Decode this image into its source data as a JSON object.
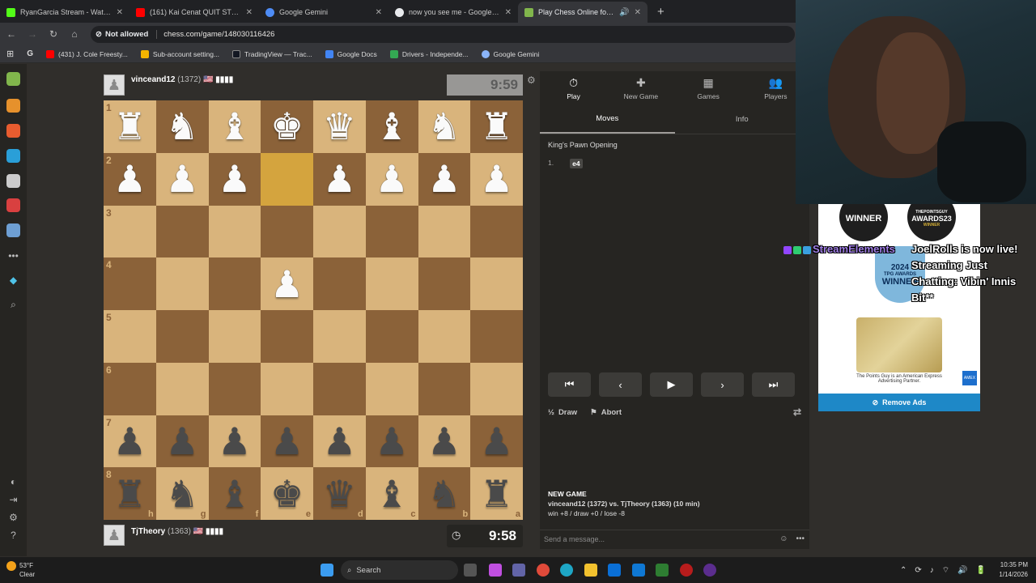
{
  "browser": {
    "tabs": [
      {
        "title": "RyanGarcia Stream - Watch Live",
        "color": "#53fc18",
        "active": false
      },
      {
        "title": "(161) Kai Cenat QUIT STREAMIN",
        "color": "#ff0000",
        "active": false
      },
      {
        "title": "Google Gemini",
        "color": "#4e8cf5",
        "active": false
      },
      {
        "title": "now you see me - Google Search",
        "color": "#e8eaed",
        "active": false
      },
      {
        "title": "Play Chess Online for FREE",
        "color": "#81b64c",
        "active": true
      }
    ],
    "security": "Not allowed",
    "url": "chess.com/game/148030116426",
    "bookmarks": [
      {
        "label": "(431) J. Cole Freesty...",
        "color": "#ff0000"
      },
      {
        "label": "Sub-account setting...",
        "color": "#f4b400"
      },
      {
        "label": "TradingView — Trac...",
        "color": "#131722"
      },
      {
        "label": "Google Docs",
        "color": "#4285f4"
      },
      {
        "label": "Drivers - Independe...",
        "color": "#34a853"
      },
      {
        "label": "Google Gemini",
        "color": "#8ab4f8"
      }
    ]
  },
  "game": {
    "top_player": {
      "name": "vinceand12",
      "rating": "(1372)",
      "flag": "🇺🇸",
      "bars": "▮▮▮▮",
      "clock": "9:59"
    },
    "bottom_player": {
      "name": "TjTheory",
      "rating": "(1363)",
      "flag": "🇺🇸",
      "bars": "▮▮▮▮",
      "clock": "9:58"
    },
    "rank_labels": [
      "1",
      "2",
      "3",
      "4",
      "5",
      "6",
      "7",
      "8"
    ],
    "file_labels": [
      "h",
      "g",
      "f",
      "e",
      "d",
      "c",
      "b",
      "a"
    ],
    "white_back": [
      "♜",
      "♞",
      "♝",
      "♚",
      "♛",
      "♝",
      "♞",
      "♜"
    ],
    "black_back": [
      "♜",
      "♞",
      "♝",
      "♚",
      "♛",
      "♝",
      "♞",
      "♜"
    ],
    "white_pawn": "♟",
    "black_pawn": "♟"
  },
  "panel": {
    "tabs": [
      {
        "icon": "⏱",
        "label": "Play"
      },
      {
        "icon": "✚",
        "label": "New Game"
      },
      {
        "icon": "▦",
        "label": "Games"
      },
      {
        "icon": "👥",
        "label": "Players"
      }
    ],
    "subtabs": [
      "Moves",
      "Info"
    ],
    "opening": "King's Pawn Opening",
    "move_number": "1.",
    "move": "e4",
    "draw": "Draw",
    "abort": "Abort",
    "new_game_heading": "NEW GAME",
    "new_game_line": "vinceand12 (1372) vs. TjTheory (1363) (10 min)",
    "score_line": "win +8 / draw +0 / lose -8",
    "chat_placeholder": "Send a message..."
  },
  "overlay": {
    "award1": "WINNER",
    "award2_top": "THEPOINTSGUY",
    "award2_mid": "AWARDS23",
    "award2_bottom": "WINNER",
    "shield_year": "2024",
    "shield_label": "TPG AWARDS",
    "shield_winner": "WINNER",
    "ad_footer": "The Points Guy is an American Express Advertising Partner.",
    "amex": "AMEX",
    "remove_ads": "Remove Ads",
    "se_name": "StreamElements",
    "se_message": "JoelRolls is now live! Streaming Just Chatting: Vibin' Innis Bit**"
  },
  "taskbar": {
    "temp": "53°F",
    "weather": "Clear",
    "search": "Search",
    "time": "10:35 PM",
    "date": "1/14/2026"
  }
}
